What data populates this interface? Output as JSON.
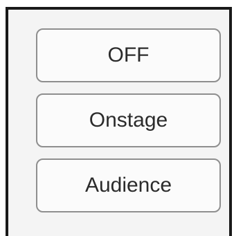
{
  "mode_selector": {
    "buttons": [
      {
        "label": "OFF"
      },
      {
        "label": "Onstage"
      },
      {
        "label": "Audience"
      }
    ]
  }
}
